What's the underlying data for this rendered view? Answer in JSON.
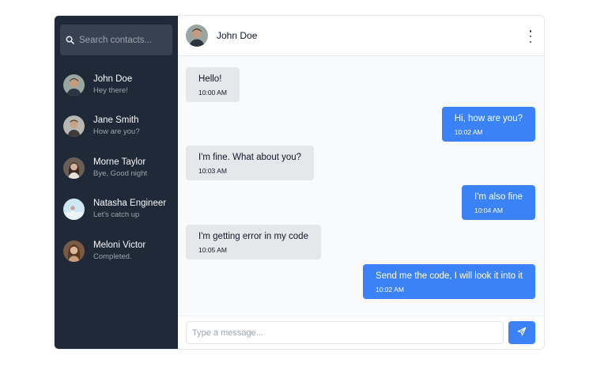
{
  "search": {
    "placeholder": "Search contacts...",
    "icon": "search-icon"
  },
  "contacts": [
    {
      "name": "John Doe",
      "preview": "Hey there!"
    },
    {
      "name": "Jane Smith",
      "preview": "How are you?"
    },
    {
      "name": "Morne Taylor",
      "preview": "Bye, Good night"
    },
    {
      "name": "Natasha Engineer",
      "preview": "Let's catch up"
    },
    {
      "name": "Meloni Victor",
      "preview": "Completed."
    }
  ],
  "chat": {
    "title": "John Doe",
    "menu_icon": "more-vertical-icon",
    "messages": [
      {
        "direction": "in",
        "text": "Hello!",
        "time": "10:00 AM"
      },
      {
        "direction": "out",
        "text": "Hi, how are you?",
        "time": "10:02 AM"
      },
      {
        "direction": "in",
        "text": "I'm fine. What about you?",
        "time": "10:03 AM"
      },
      {
        "direction": "out",
        "text": "I'm also fine",
        "time": "10:04 AM"
      },
      {
        "direction": "in",
        "text": "I'm getting error in my code",
        "time": "10:05 AM"
      },
      {
        "direction": "out",
        "text": "Send me the code, I will look it into it",
        "time": "10:02 AM"
      }
    ]
  },
  "composer": {
    "placeholder": "Type a message...",
    "send_icon": "send-icon"
  },
  "colors": {
    "sidebar_bg": "#1f2937",
    "accent": "#3b82f6",
    "incoming_bubble": "#e5e7eb",
    "chat_bg": "#f9fafb"
  }
}
